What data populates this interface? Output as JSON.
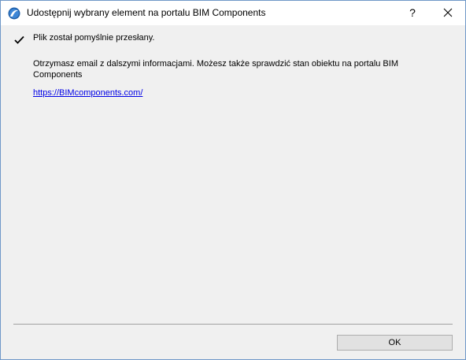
{
  "window": {
    "title": "Udostępnij wybrany element na portalu BIM Components",
    "help_label": "?",
    "icons": {
      "app": "archicad-icon",
      "close": "close-icon",
      "status": "check-icon"
    }
  },
  "content": {
    "status_message": "Plik został pomyślnie przesłany.",
    "info_message": "Otrzymasz email z dalszymi informacjami. Możesz także sprawdzić stan obiektu na portalu BIM Components",
    "link_text": "https://BIMcomponents.com/"
  },
  "footer": {
    "ok_label": "OK"
  },
  "colors": {
    "window_border": "#6f98c8",
    "dialog_background": "#f0f0f0",
    "link": "#0000e6",
    "button_face": "#e1e1e1"
  }
}
